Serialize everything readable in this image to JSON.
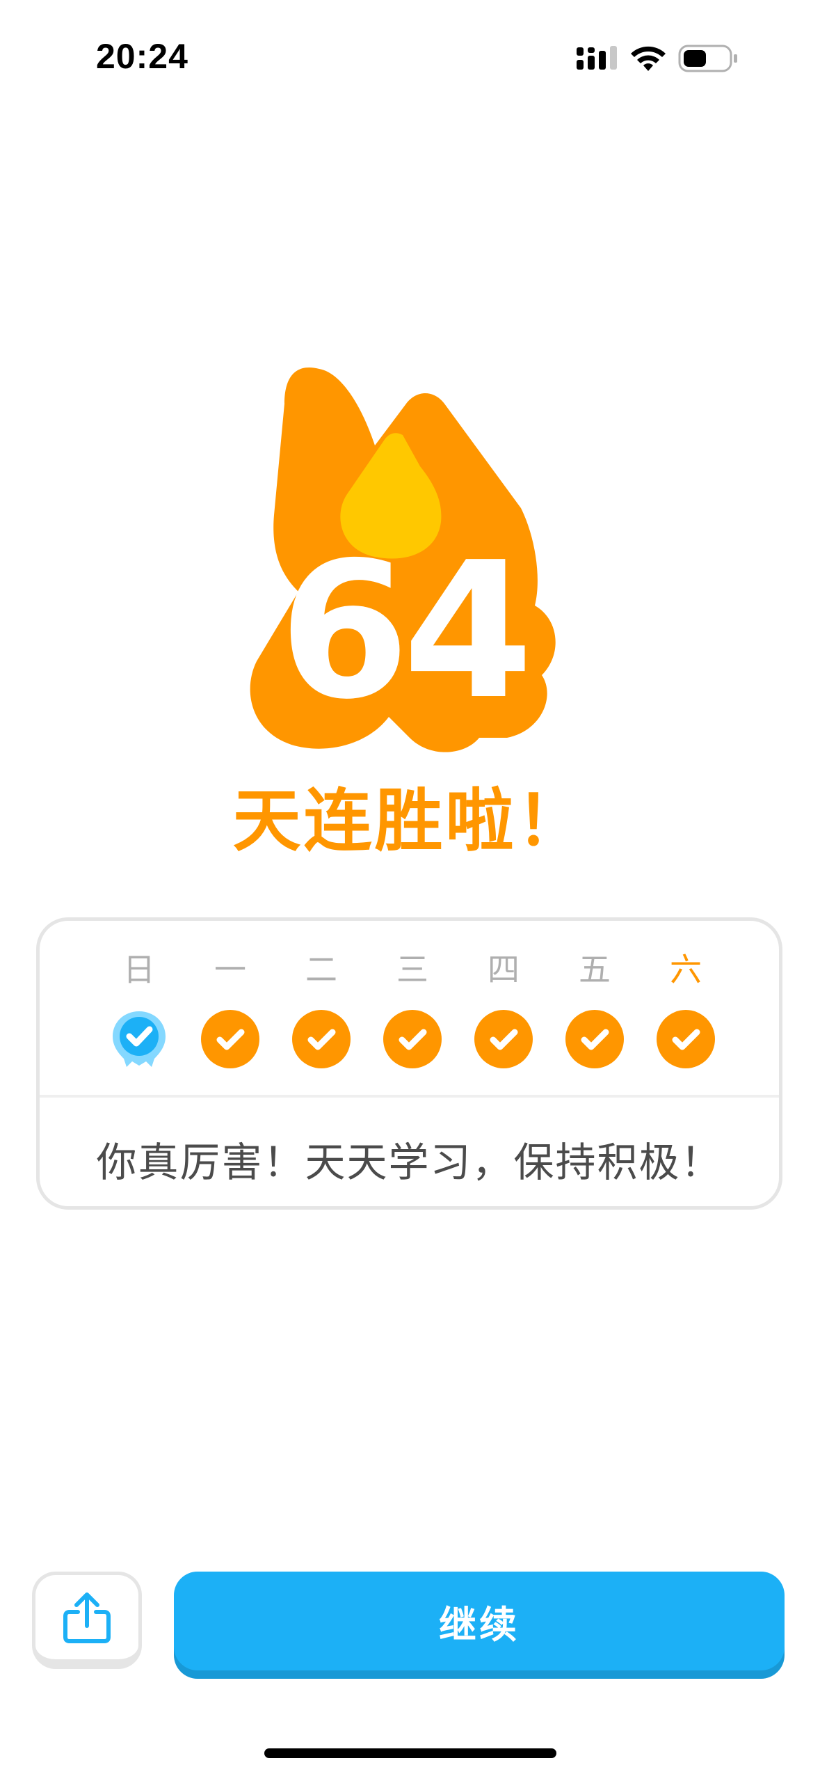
{
  "status_bar": {
    "time": "20:24",
    "icons": [
      "cellular-signal-icon",
      "wifi-icon",
      "battery-icon"
    ]
  },
  "hero": {
    "streak_count": "64",
    "title": "天连胜啦！",
    "colors": {
      "flame": "#ff9600",
      "flame_inner": "#ffc800",
      "text": "#ff9600"
    }
  },
  "week": {
    "days": [
      {
        "label": "日",
        "status": "freeze",
        "icon": "streak-freeze-icon"
      },
      {
        "label": "一",
        "status": "done",
        "icon": "check-icon"
      },
      {
        "label": "二",
        "status": "done",
        "icon": "check-icon"
      },
      {
        "label": "三",
        "status": "done",
        "icon": "check-icon"
      },
      {
        "label": "四",
        "status": "done",
        "icon": "check-icon"
      },
      {
        "label": "五",
        "status": "done",
        "icon": "check-icon"
      },
      {
        "label": "六",
        "status": "done",
        "icon": "check-icon",
        "today": true
      }
    ],
    "message": "你真厉害！天天学习，保持积极！"
  },
  "actions": {
    "share_icon": "share-icon",
    "continue_label": "继续",
    "continue_color": "#1cb0f6"
  }
}
